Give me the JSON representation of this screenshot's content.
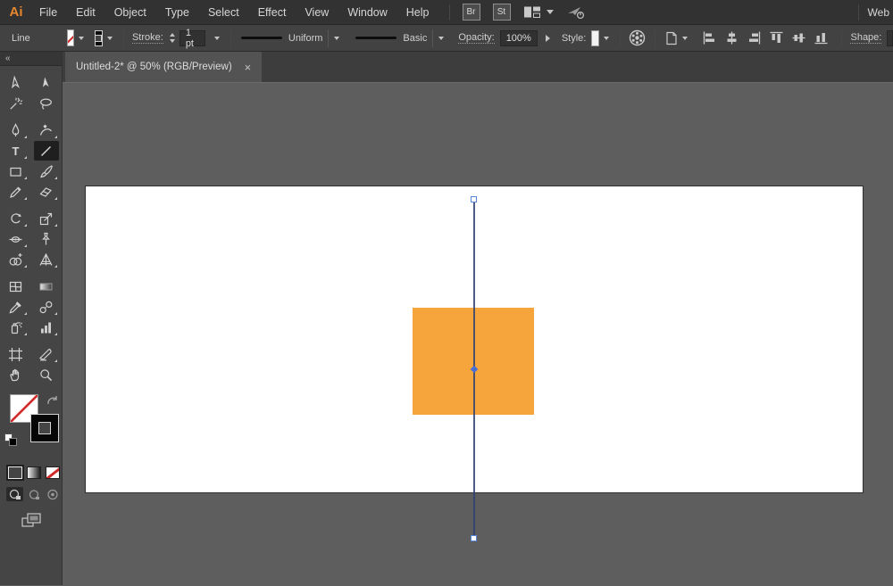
{
  "menubar": {
    "logo": "Ai",
    "items": [
      "File",
      "Edit",
      "Object",
      "Type",
      "Select",
      "Effect",
      "View",
      "Window",
      "Help"
    ],
    "bridge_button": "Br",
    "stock_button": "St",
    "workspace_name": "Web"
  },
  "controlbar": {
    "context_label": "Line",
    "stroke_label": "Stroke:",
    "stroke_weight": "1 pt",
    "variable_width_profile": "Uniform",
    "brush_definition": "Basic",
    "opacity_label": "Opacity:",
    "opacity_value": "100%",
    "style_label": "Style:",
    "shape_label": "Shape:"
  },
  "document_tab": {
    "title": "Untitled-2* @ 50% (RGB/Preview)",
    "close_glyph": "×"
  },
  "toolbar": {
    "collapse_glyph": "«",
    "type_tool_glyph": "T",
    "selected_tool": "line-segment-tool"
  },
  "colors": {
    "rectangle_fill": "#F5A53C",
    "selection_line": "#2E4271",
    "anchor_stroke": "#5B86D7",
    "midpoint_fill": "#466FD4",
    "artboard_bg": "#FFFFFF",
    "canvas_bg": "#5E5E5E",
    "color_swatch": "#F2A33C"
  }
}
